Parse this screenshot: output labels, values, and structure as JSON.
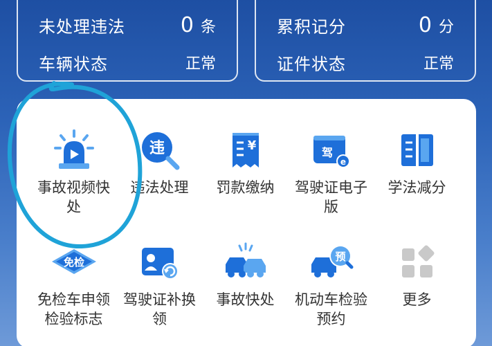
{
  "stats": {
    "left": {
      "violation_label": "未处理违法",
      "violation_count": "0",
      "violation_unit": "条",
      "vehicle_label": "车辆状态",
      "vehicle_status": "正常"
    },
    "right": {
      "points_label": "累积记分",
      "points_count": "0",
      "points_unit": "分",
      "license_label": "证件状态",
      "license_status": "正常"
    }
  },
  "services": [
    {
      "label": "事故视频快处",
      "icon": "siren-video-icon"
    },
    {
      "label": "违法处理",
      "icon": "violation-search-icon"
    },
    {
      "label": "罚款缴纳",
      "icon": "fine-receipt-icon"
    },
    {
      "label": "驾驶证电子版",
      "icon": "e-license-icon"
    },
    {
      "label": "学法减分",
      "icon": "open-book-icon"
    },
    {
      "label": "免检车申领检验标志",
      "icon": "inspection-exempt-icon"
    },
    {
      "label": "驾驶证补换领",
      "icon": "license-renew-icon"
    },
    {
      "label": "事故快处",
      "icon": "car-accident-icon"
    },
    {
      "label": "机动车检验预约",
      "icon": "vehicle-appointment-icon"
    },
    {
      "label": "更多",
      "icon": "more-grid-icon"
    }
  ],
  "colors": {
    "primary_blue": "#1e6fd9",
    "light_blue": "#5aa6f0",
    "annotation": "#1fa3d8"
  }
}
